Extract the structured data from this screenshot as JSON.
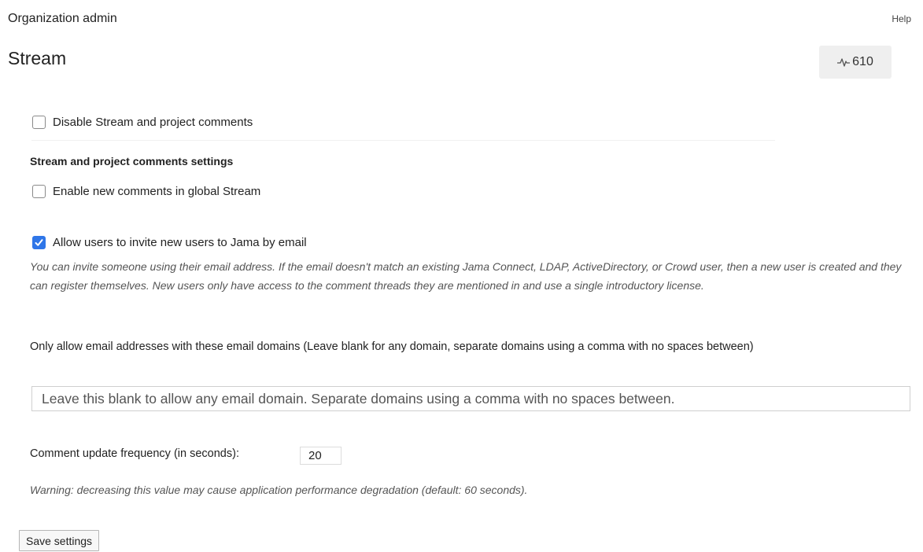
{
  "header": {
    "breadcrumb": "Organization admin",
    "help_label": "Help",
    "title": "Stream",
    "activity_badge": {
      "icon": "activity-pulse-icon",
      "count": "610"
    }
  },
  "settings": {
    "disable_stream": {
      "label": "Disable Stream and project comments",
      "checked": false
    },
    "section_heading": "Stream and project comments settings",
    "enable_global_comments": {
      "label": "Enable new comments in global Stream",
      "checked": false
    },
    "allow_invite": {
      "label": "Allow users to invite new users to Jama by email",
      "checked": true
    },
    "invite_help_text": "You can invite someone using their email address. If the email doesn't match an existing Jama Connect, LDAP, ActiveDirectory, or Crowd user, then a new user is created and they can register themselves. New users only have access to the comment threads they are mentioned in and use a single introductory license.",
    "domains_label": "Only allow email addresses with these email domains (Leave blank for any domain, separate domains using a comma with no spaces between)",
    "domains_placeholder": "Leave this blank to allow any email domain. Separate domains using a comma with no spaces between.",
    "domains_value": "",
    "frequency_label": "Comment update frequency (in seconds):",
    "frequency_value": "20",
    "frequency_warning": "Warning: decreasing this value may cause application performance degradation (default: 60 seconds).",
    "save_label": "Save settings"
  },
  "colors": {
    "checkbox_checked": "#2f76e8",
    "text": "#222222",
    "help_text": "#555555",
    "badge_bg": "#efefef"
  }
}
